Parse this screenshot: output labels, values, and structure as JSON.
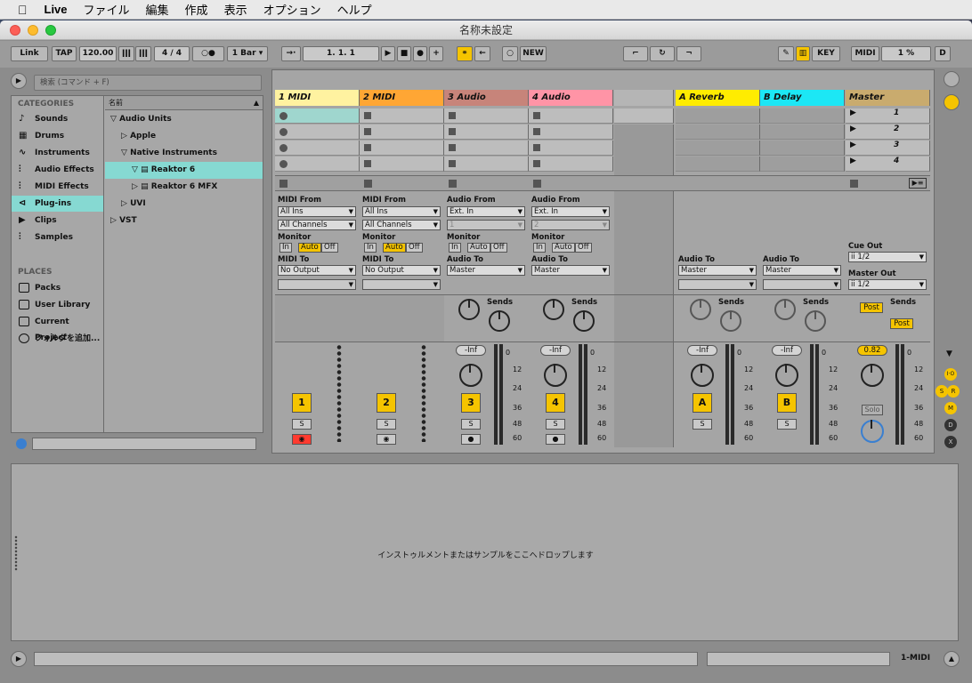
{
  "menubar": {
    "apple": "",
    "app": "Live",
    "items": [
      "ファイル",
      "編集",
      "作成",
      "表示",
      "オプション",
      "ヘルプ"
    ]
  },
  "window": {
    "title": "名称未設定"
  },
  "control": {
    "link": "Link",
    "tap": "TAP",
    "tempo": "120.00",
    "sig": "4  /  4",
    "quant": "1 Bar",
    "pos": "1.   1.   1",
    "new": "NEW",
    "key": "KEY",
    "midi": "MIDI",
    "cpu": "1 %",
    "d": "D"
  },
  "browser": {
    "search_placeholder": "検索 (コマンド + F)",
    "categories_title": "CATEGORIES",
    "categories": [
      {
        "label": "Sounds",
        "icon": "note-icon"
      },
      {
        "label": "Drums",
        "icon": "grid-icon"
      },
      {
        "label": "Instruments",
        "icon": "wave-icon"
      },
      {
        "label": "Audio Effects",
        "icon": "audio-fx-icon"
      },
      {
        "label": "MIDI Effects",
        "icon": "midi-fx-icon"
      },
      {
        "label": "Plug-ins",
        "icon": "plug-icon"
      },
      {
        "label": "Clips",
        "icon": "clips-icon"
      },
      {
        "label": "Samples",
        "icon": "samples-icon"
      }
    ],
    "places_title": "PLACES",
    "places": [
      "Packs",
      "User Library",
      "Current Project",
      "フォルダを追加..."
    ],
    "name_header": "名前",
    "tree": [
      {
        "label": "Audio Units",
        "indent": 0,
        "arrow": "▽"
      },
      {
        "label": "Apple",
        "indent": 1,
        "arrow": "▷"
      },
      {
        "label": "Native Instruments",
        "indent": 1,
        "arrow": "▽"
      },
      {
        "label": "Reaktor 6",
        "indent": 2,
        "arrow": "▽"
      },
      {
        "label": "Reaktor 6 MFX",
        "indent": 2,
        "arrow": "▷"
      },
      {
        "label": "UVI",
        "indent": 1,
        "arrow": "▷"
      },
      {
        "label": "VST",
        "indent": 0,
        "arrow": "▷"
      }
    ]
  },
  "tracks": [
    {
      "name": "1 MIDI",
      "color": "#fff2a0",
      "num": "1"
    },
    {
      "name": "2 MIDI",
      "color": "#ffa634",
      "num": "2"
    },
    {
      "name": "3 Audio",
      "color": "#c7847a",
      "num": "3"
    },
    {
      "name": "4 Audio",
      "color": "#ff94a6",
      "num": "4"
    },
    {
      "name": "",
      "color": "#b5b5b5",
      "num": ""
    },
    {
      "name": "A Reverb",
      "color": "#ffec00",
      "num": "A"
    },
    {
      "name": "B Delay",
      "color": "#1ce7f5",
      "num": "B"
    },
    {
      "name": "Master",
      "color": "#c9ab6e",
      "num": ""
    }
  ],
  "scenes": [
    "1",
    "2",
    "3",
    "4"
  ],
  "io": {
    "midi_from": "MIDI From",
    "audio_from": "Audio From",
    "all_ins": "All Ins",
    "all_channels": "All Channels",
    "ext_in": "Ext. In",
    "ch1": "1",
    "ch2": "2",
    "monitor": "Monitor",
    "in": "In",
    "auto": "Auto",
    "off": "Off",
    "midi_to": "MIDI To",
    "no_output": "No Output",
    "audio_to": "Audio To",
    "master": "Master",
    "cue_out": "Cue Out",
    "cue_val": "ii 1/2",
    "master_out": "Master Out",
    "master_val": "ii 1/2",
    "sends": "Sends",
    "post": "Post",
    "inf": "-Inf",
    "master_vol": "0.82",
    "solo": "Solo",
    "s": "S",
    "db": [
      "0",
      "12",
      "24",
      "36",
      "48",
      "60"
    ]
  },
  "detail": {
    "message": "インストゥルメントまたはサンプルをここへドロップします"
  },
  "status": {
    "track": "1-MIDI"
  },
  "side": [
    "I·O",
    "S",
    "R",
    "M",
    "D",
    "X"
  ]
}
